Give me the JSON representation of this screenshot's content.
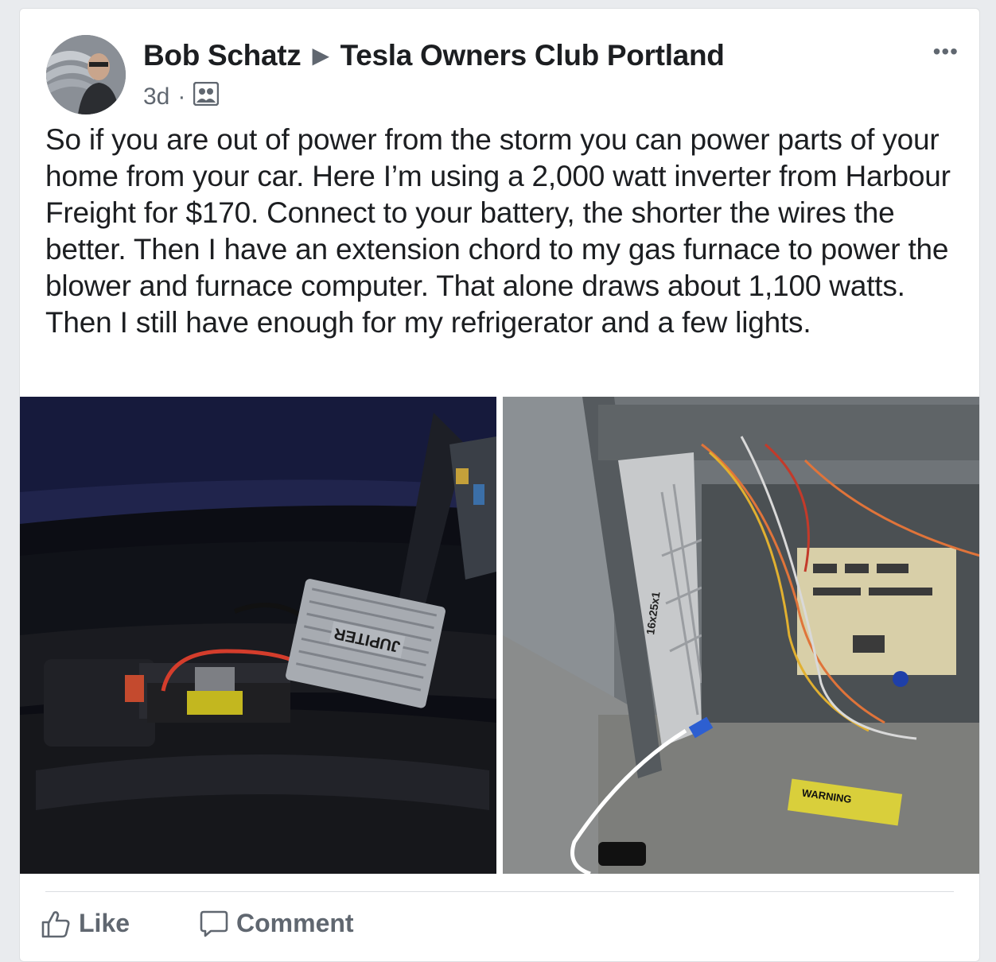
{
  "post": {
    "author": "Bob Schatz",
    "group": "Tesla Owners Club Portland",
    "time": "3d",
    "dot": "·",
    "audience_icon": "group-icon",
    "more_label": "•••",
    "text": "So if you are out of power from the storm you can power parts of your home from your car. Here I’m using a 2,000 watt inverter from Harbour Freight for $170. Connect to your battery, the shorter the wires the better. Then I have an extension chord to my gas furnace to power the blower and furnace computer. That alone draws about 1,100 watts. Then I still have enough for my refrigerator and a few lights."
  },
  "photos": {
    "left": {
      "inverter_label": "JUPITER"
    },
    "right": {
      "filter_label": "16x25x1",
      "warning_label": "WARNING"
    }
  },
  "actions": {
    "like_label": "Like",
    "comment_label": "Comment",
    "like_icon": "thumbs-up-icon",
    "comment_icon": "comment-icon"
  }
}
